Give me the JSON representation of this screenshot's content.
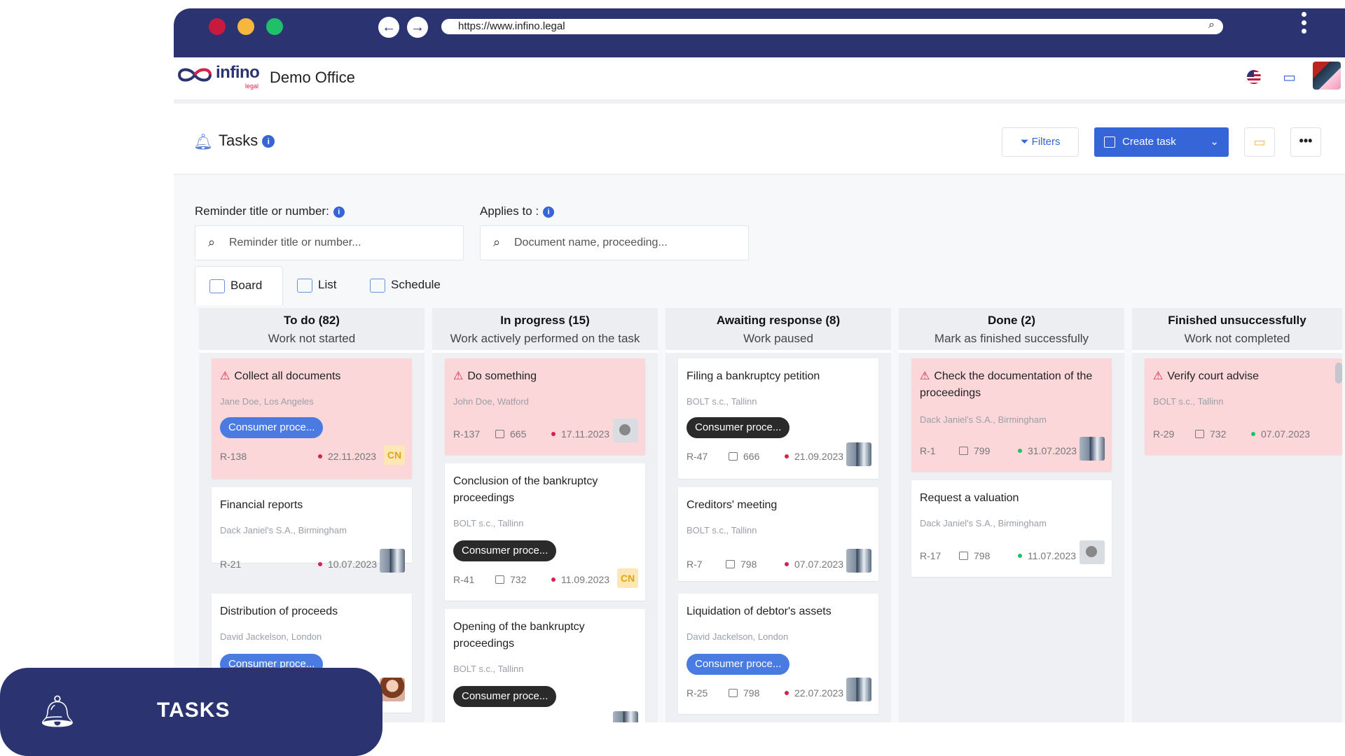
{
  "browser": {
    "url": "https://www.infino.legal"
  },
  "app": {
    "brand": "infino",
    "brand_sub": "legal",
    "office": "Demo Office"
  },
  "tasks": {
    "title": "Tasks",
    "filters_label": "Filters",
    "create_label": "Create task",
    "more_label": "•••"
  },
  "filters": {
    "reminder_label": "Reminder title or number:",
    "reminder_placeholder": "Reminder title or number...",
    "applies_label": "Applies to :",
    "applies_placeholder": "Document name, proceeding..."
  },
  "view_tabs": [
    {
      "label": "Board"
    },
    {
      "label": "List"
    },
    {
      "label": "Schedule"
    }
  ],
  "columns": [
    {
      "title": "To do (82)",
      "subtitle": "Work not started"
    },
    {
      "title": "In progress (15)",
      "subtitle": "Work actively performed on the task"
    },
    {
      "title": "Awaiting response (8)",
      "subtitle": "Work paused"
    },
    {
      "title": "Done (2)",
      "subtitle": "Mark as finished successfully"
    },
    {
      "title": "Finished unsuccessfully",
      "subtitle": "Work not completed"
    }
  ],
  "cards": {
    "c1": {
      "title": "Collect all documents",
      "client": "Jane Doe, Los Angeles",
      "badge": "Consumer proce...",
      "num": "R-138",
      "date": "22.11.2023",
      "tag": "CN"
    },
    "c2": {
      "title": "Financial reports",
      "client": "Dack Janiel's S.A., Birmingham",
      "num": "R-21",
      "date": "10.07.2023"
    },
    "c3": {
      "title": "Distribution of proceeds",
      "client": "David Jackelson, London",
      "badge": "Consumer proce..."
    },
    "c4": {
      "title": "Do something",
      "client": "John Doe, Watford",
      "num": "R-137",
      "doc": "665",
      "date": "17.11.2023"
    },
    "c5": {
      "title": "Conclusion of the bankruptcy proceedings",
      "client": "BOLT s.c., Tallinn",
      "badge": "Consumer proce...",
      "num": "R-41",
      "doc": "732",
      "date": "11.09.2023",
      "tag": "CN"
    },
    "c6": {
      "title": "Opening of the bankruptcy proceedings",
      "client": "BOLT s.c., Tallinn",
      "badge": "Consumer proce..."
    },
    "c7": {
      "title": "Filing a bankruptcy petition",
      "client": "BOLT s.c., Tallinn",
      "badge": "Consumer proce...",
      "num": "R-47",
      "doc": "666",
      "date": "21.09.2023"
    },
    "c8": {
      "title": "Creditors' meeting",
      "client": "BOLT s.c., Tallinn",
      "num": "R-7",
      "doc": "798",
      "date": "07.07.2023"
    },
    "c9": {
      "title": "Liquidation of debtor's assets",
      "client": "David Jackelson, London",
      "badge": "Consumer proce...",
      "num": "R-25",
      "doc": "798",
      "date": "22.07.2023"
    },
    "c10": {
      "title": "Check the documentation of the proceedings",
      "client": "Dack Janiel's S.A., Birmingham",
      "num": "R-1",
      "doc": "799",
      "date": "31.07.2023"
    },
    "c11": {
      "title": "Request a valuation",
      "client": "Dack Janiel's S.A., Birmingham",
      "num": "R-17",
      "doc": "798",
      "date": "11.07.2023"
    },
    "c12": {
      "title": "Verify court advise",
      "client": "BOLT s.c., Tallinn",
      "num": "R-29",
      "doc": "732",
      "date": "07.07.2023"
    }
  },
  "banner": {
    "label": "TASKS"
  },
  "colors": {
    "navy": "#2b3471",
    "accent": "#3565d6",
    "alert_card": "#fbd7d9"
  }
}
